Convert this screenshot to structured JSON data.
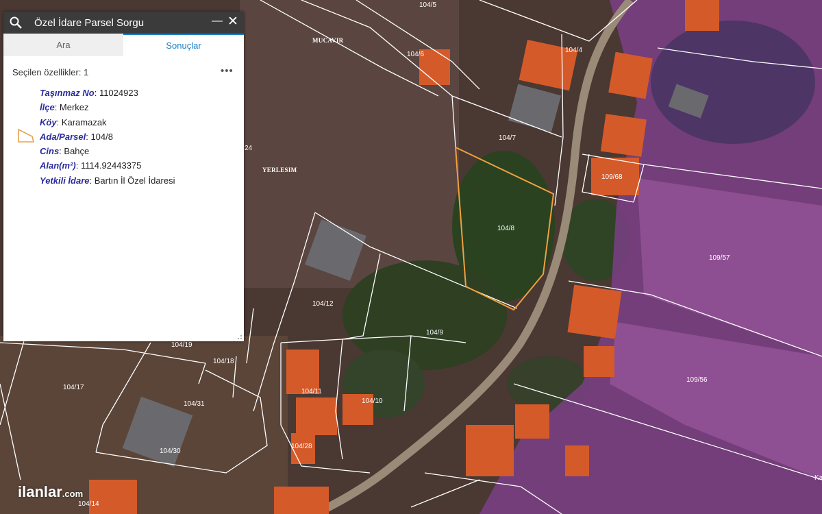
{
  "panel": {
    "title": "Özel İdare Parsel Sorgu",
    "tabs": [
      "Ara",
      "Sonuçlar"
    ],
    "active_tab": "Sonuçlar",
    "selected_count_label": "Seçilen özellikler: 1",
    "more_label": "•••",
    "attributes": [
      {
        "key": "Taşınmaz No",
        "value": "11024923"
      },
      {
        "key": "İlçe",
        "value": "Merkez"
      },
      {
        "key": "Köy",
        "value": "Karamazak"
      },
      {
        "key": "Ada/Parsel",
        "value": "104/8"
      },
      {
        "key": "Cins",
        "value": "Bahçe"
      },
      {
        "key": "Alan(m²)",
        "value": "1114.92443375"
      },
      {
        "key": "Yetkili İdare",
        "value": "Bartın İl Özel İdaresi"
      }
    ]
  },
  "map": {
    "place_labels": [
      "MUCAVIR",
      "YERLESIM"
    ],
    "parcel_labels": [
      "104/5",
      "104/6",
      "104/4",
      "104/7",
      "109/68",
      "104/8",
      "109/57",
      "24",
      "104/12",
      "104/9",
      "104/19",
      "104/18",
      "104/17",
      "104/31",
      "104/11",
      "104/10",
      "104/30",
      "104/28",
      "109/56",
      "104/14",
      "Ka"
    ],
    "highlighted_parcel": "104/8",
    "highlight_color": "#f0a040"
  },
  "watermark": {
    "main": "ilanlar",
    "suffix": ".com"
  }
}
